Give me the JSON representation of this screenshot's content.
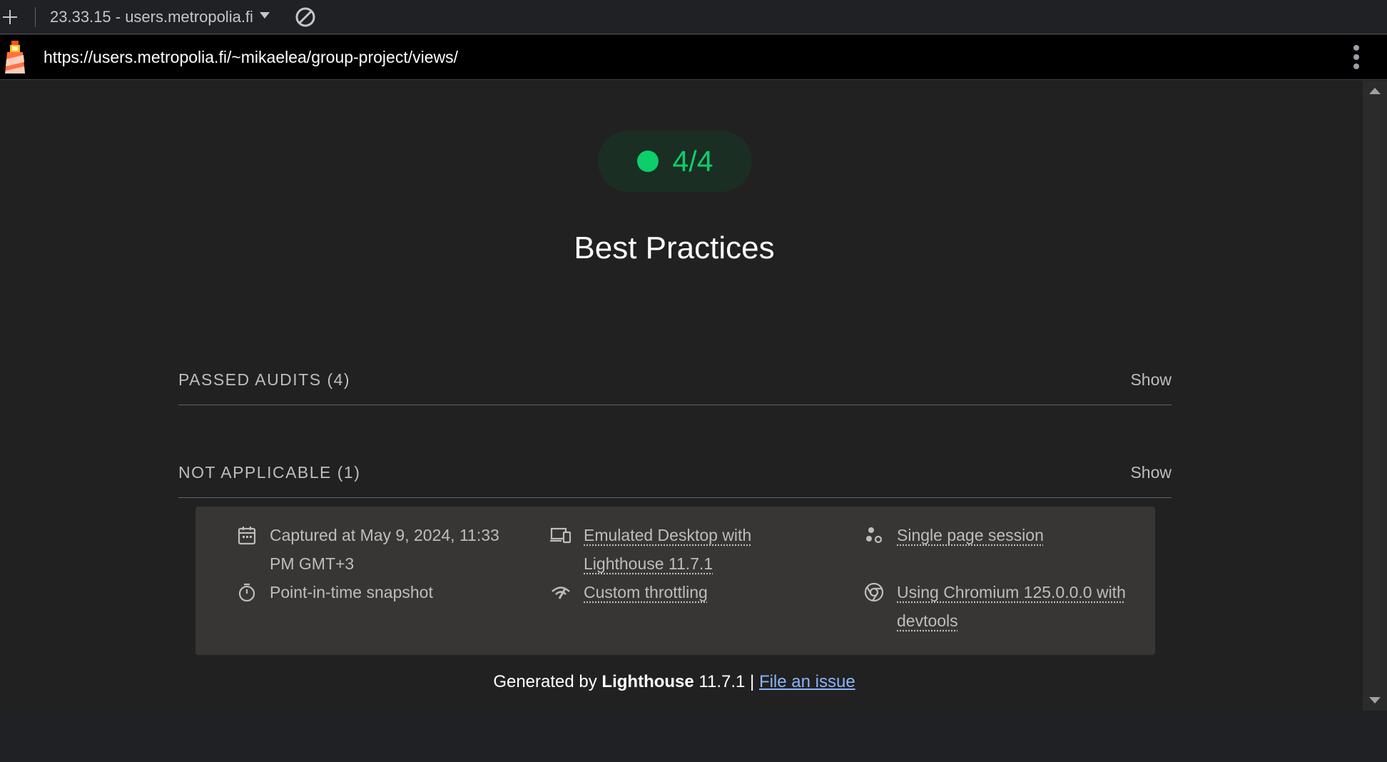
{
  "toolbar": {
    "report_name": "23.33.15 - users.metropolia.fi"
  },
  "urlbar": {
    "url": "https://users.metropolia.fi/~mikaelea/group-project/views/"
  },
  "category": {
    "score": "4/4",
    "title": "Best Practices",
    "score_color": "#0cce6b"
  },
  "groups": [
    {
      "title": "PASSED AUDITS (4)",
      "toggle": "Show"
    },
    {
      "title": "NOT APPLICABLE (1)",
      "toggle": "Show"
    }
  ],
  "meta": {
    "captured": "Captured at May 9, 2024, 11:33 PM GMT+3",
    "snapshot": "Point-in-time snapshot",
    "emulated": "Emulated Desktop with Lighthouse 11.7.1",
    "throttling": "Custom throttling",
    "session": "Single page session",
    "browser": "Using Chromium 125.0.0.0 with devtools"
  },
  "footer": {
    "prefix": "Generated by ",
    "product": "Lighthouse",
    "version": " 11.7.1 | ",
    "issue_link": "File an issue"
  }
}
